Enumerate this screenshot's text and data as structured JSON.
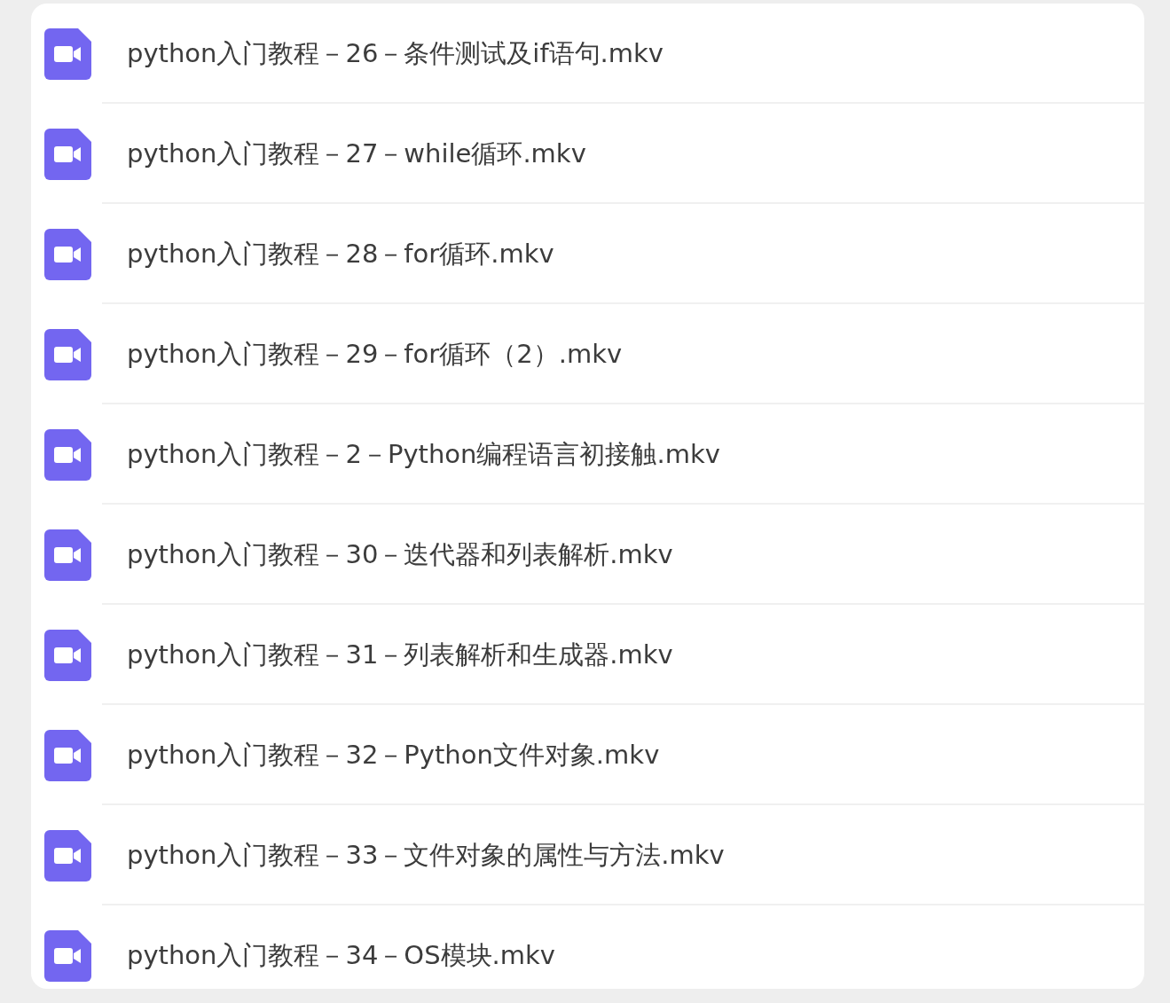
{
  "files": [
    {
      "name": "python入门教程－26－条件测试及if语句.mkv"
    },
    {
      "name": "python入门教程－27－while循环.mkv"
    },
    {
      "name": "python入门教程－28－for循环.mkv"
    },
    {
      "name": "python入门教程－29－for循环（2）.mkv"
    },
    {
      "name": "python入门教程－2－Python编程语言初接触.mkv"
    },
    {
      "name": "python入门教程－30－迭代器和列表解析.mkv"
    },
    {
      "name": "python入门教程－31－列表解析和生成器.mkv"
    },
    {
      "name": "python入门教程－32－Python文件对象.mkv"
    },
    {
      "name": "python入门教程－33－文件对象的属性与方法.mkv"
    },
    {
      "name": "python入门教程－34－OS模块.mkv"
    }
  ]
}
